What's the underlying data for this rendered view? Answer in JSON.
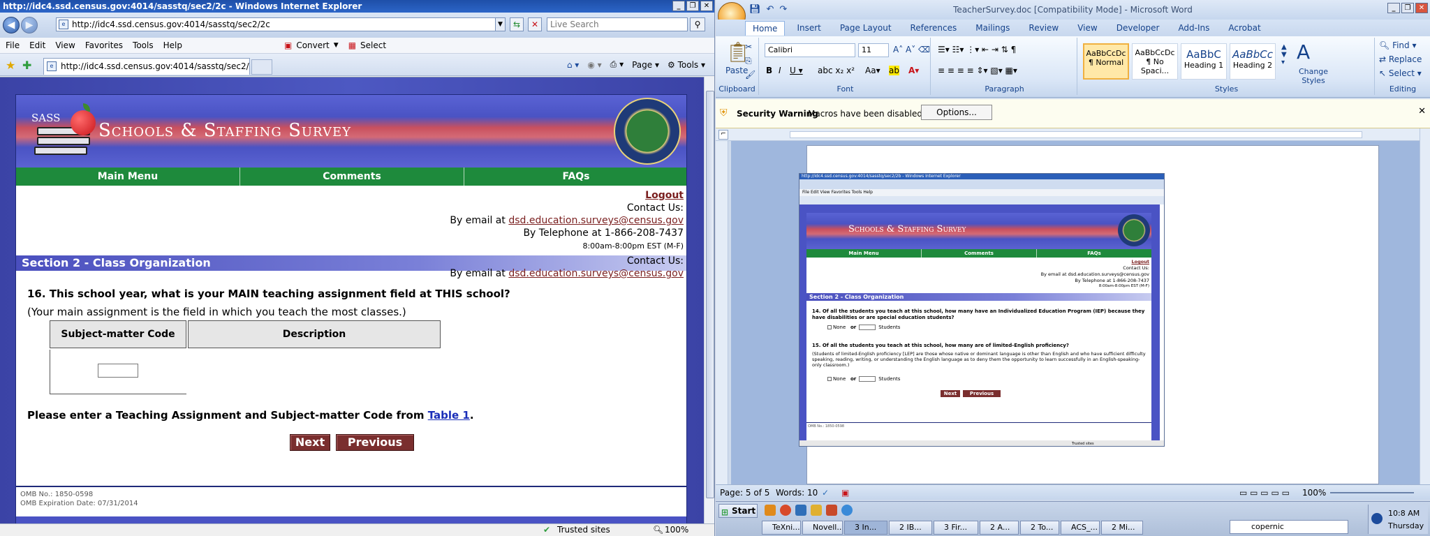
{
  "ie": {
    "title": "http://idc4.ssd.census.gov:4014/sasstq/sec2/2c - Windows Internet Explorer",
    "url": "http://idc4.ssd.census.gov:4014/sasstq/sec2/2c",
    "search_placeholder": "Live Search",
    "menu": [
      "File",
      "Edit",
      "View",
      "Favorites",
      "Tools",
      "Help"
    ],
    "convert_label": "Convert",
    "select_label": "Select",
    "tab_label": "http://idc4.ssd.census.gov:4014/sasstq/sec2/2c",
    "page_menu": "Page",
    "tools_menu": "Tools",
    "status": {
      "zone": "Trusted sites",
      "zoom": "100%"
    }
  },
  "site": {
    "sass_label": "SASS",
    "banner_title": "Schools & Staffing Survey",
    "nav": [
      "Main Menu",
      "Comments",
      "FAQs"
    ],
    "logout": "Logout",
    "contact_label": "Contact Us:",
    "email_prefix": "By email at",
    "email": "dsd.education.surveys@census.gov",
    "telephone": "By Telephone at 1-866-208-7437",
    "hours": "8:00am-8:00pm EST (M-F)",
    "section_title": "Section 2 - Class Organization",
    "question": "16. This school year, what is your MAIN teaching assignment field at THIS school?",
    "question_note": "(Your main assignment is the field in which you teach the most classes.)",
    "table_headers": [
      "Subject-matter Code",
      "Description"
    ],
    "instruction_prefix": "Please enter a Teaching Assignment and Subject-matter Code from",
    "instruction_link": "Table 1",
    "next": "Next",
    "previous": "Previous",
    "omb_no": "OMB No.: 1850-0598",
    "omb_exp": "OMB Expiration Date: 07/31/2014"
  },
  "word": {
    "title": "TeacherSurvey.doc [Compatibility Mode] - Microsoft Word",
    "tabs": [
      "Home",
      "Insert",
      "Page Layout",
      "References",
      "Mailings",
      "Review",
      "View",
      "Developer",
      "Add-Ins",
      "Acrobat"
    ],
    "font_name": "Calibri",
    "font_size": "11",
    "paste": "Paste",
    "groups": [
      "Clipboard",
      "Font",
      "Paragraph",
      "Styles",
      "Editing"
    ],
    "styles": [
      {
        "preview": "AaBbCcDc",
        "name": "¶ Normal"
      },
      {
        "preview": "AaBbCcDc",
        "name": "¶ No Spaci..."
      },
      {
        "preview": "AaBbC",
        "name": "Heading 1"
      },
      {
        "preview": "AaBbCc",
        "name": "Heading 2"
      }
    ],
    "change_styles": "Change Styles",
    "editing": [
      "Find",
      "Replace",
      "Select"
    ],
    "security_title": "Security Warning",
    "security_msg": "Macros have been disabled.",
    "options": "Options...",
    "status": {
      "page": "Page: 5 of 5",
      "words": "Words: 10",
      "zoom": "100%"
    }
  },
  "embedded": {
    "title": "http://idc4.ssd.census.gov:4014/sasstq/sec2/2b - Windows Internet Explorer",
    "section": "Section 2 - Class Organization",
    "nav": [
      "Main Menu",
      "Comments",
      "FAQs"
    ],
    "logout": "Logout",
    "contact": "Contact Us:",
    "email_line": "By email at dsd.education.surveys@census.gov",
    "phone_line": "By Telephone at 1-866-208-7437",
    "hours": "8:00am-8:00pm EST (M-F)",
    "q14": "14. Of all the students you teach at this school, how many have an Individualized Education Program (IEP) because they have disabilities or are special education students?",
    "q15": "15. Of all the students you teach at this school, how many are of limited-English proficiency?",
    "q15_note": "(Students of limited-English proficiency [LEP] are those whose native or dominant language is other than English and who have sufficient difficulty speaking, reading, writing, or understanding the English language as to deny them the opportunity to learn successfully in an English-speaking-only classroom.)",
    "none": "None",
    "or": "or",
    "students": "Students",
    "next": "Next",
    "previous": "Previous",
    "omb": "OMB No.: 1850-0598",
    "zone": "Trusted sites"
  },
  "taskbar": {
    "start": "Start",
    "tasks": [
      "TeXni...",
      "Novell...",
      "3 In...",
      "2 IB...",
      "3 Fir...",
      "2 A...",
      "2 To...",
      "ACS_...",
      "2 Mi..."
    ],
    "search": "copernic",
    "time": "10:8 AM",
    "day": "Thursday"
  }
}
